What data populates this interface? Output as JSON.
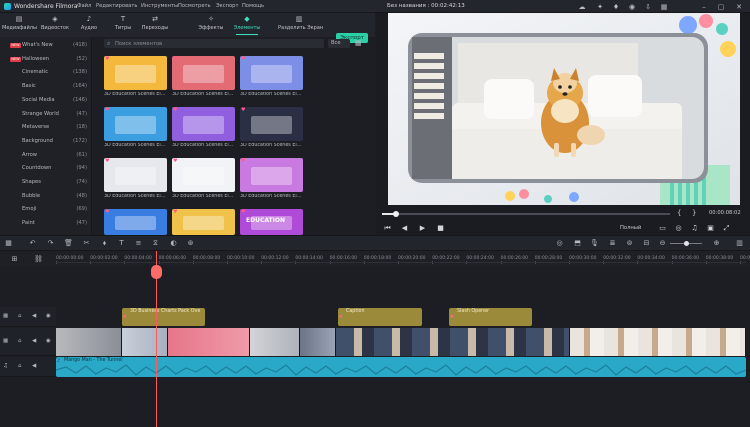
{
  "app": {
    "name": "Wondershare Filmora",
    "menu": [
      "Файл",
      "Редактировать",
      "Инструменты",
      "Посмотреть",
      "Экспорт",
      "Помощь"
    ],
    "preview_title": "Без названия : 00:02:42:13"
  },
  "tabs": [
    {
      "label": "Медиафайлы",
      "icon": "folder-icon"
    },
    {
      "label": "Видеосток",
      "icon": "stock-icon"
    },
    {
      "label": "Аудио",
      "icon": "music-icon"
    },
    {
      "label": "Титры",
      "icon": "text-icon"
    },
    {
      "label": "Переходы",
      "icon": "transition-icon"
    },
    {
      "label": "Эффекты",
      "icon": "effects-icon"
    },
    {
      "label": "Элементы",
      "icon": "elements-icon"
    },
    {
      "label": "Разделить Экран",
      "icon": "split-screen-icon"
    }
  ],
  "export_label": "Экспорт",
  "sidebar": [
    {
      "name": "What's New",
      "count": "(418)",
      "badge": "NEW"
    },
    {
      "name": "Halloween",
      "count": "(52)",
      "badge": "NEW"
    },
    {
      "name": "Cinematic",
      "count": "(138)"
    },
    {
      "name": "Basic",
      "count": "(164)"
    },
    {
      "name": "Social Media",
      "count": "(146)"
    },
    {
      "name": "Strange World",
      "count": "(47)"
    },
    {
      "name": "Metaverse",
      "count": "(18)"
    },
    {
      "name": "Background",
      "count": "(172)"
    },
    {
      "name": "Arrow",
      "count": "(61)"
    },
    {
      "name": "Countdown",
      "count": "(94)"
    },
    {
      "name": "Shapes",
      "count": "(74)"
    },
    {
      "name": "Bubble",
      "count": "(48)"
    },
    {
      "name": "Emoji",
      "count": "(69)"
    },
    {
      "name": "Paint",
      "count": "(47)"
    }
  ],
  "search": {
    "placeholder": "Поиск элементов",
    "filter": "Все"
  },
  "thumbnails": [
    {
      "caption": "3D Education Scenes El...",
      "bg": "#f4b93c"
    },
    {
      "caption": "3D Education Scenes El...",
      "bg": "#e36b74"
    },
    {
      "caption": "3D Education Scenes El...",
      "bg": "#7d8ee6"
    },
    {
      "caption": "3D Education Scenes El...",
      "bg": "#3a9ee0"
    },
    {
      "caption": "3D Education Scenes El...",
      "bg": "#8f5fe0"
    },
    {
      "caption": "3D Education Scenes El...",
      "bg": "#2a2f44"
    },
    {
      "caption": "3D Education Scenes El...",
      "bg": "#e6e8ee"
    },
    {
      "caption": "3D Education Scenes El...",
      "bg": "#f2f3f6"
    },
    {
      "caption": "3D Education Scenes El...",
      "bg": "#c97ae0"
    },
    {
      "caption": "",
      "bg": "#3a7de0"
    },
    {
      "caption": "",
      "bg": "#f0c24a"
    },
    {
      "caption": "EDUCATION",
      "bg": "#b04ad8"
    }
  ],
  "preview": {
    "timecode": "00:00:08:02",
    "quality": "Полный",
    "progress": 0.05
  },
  "ruler": [
    "00:00:00:00",
    "00:00:02:00",
    "00:00:04:00",
    "00:00:06:00",
    "00:00:08:00",
    "00:00:10:00",
    "00:00:12:00",
    "00:00:14:00",
    "00:00:16:00",
    "00:00:18:00",
    "00:00:20:00",
    "00:00:22:00",
    "00:00:24:00",
    "00:00:26:00",
    "00:00:28:00",
    "00:00:30:00",
    "00:00:32:00",
    "00:00:34:00",
    "00:00:36:00",
    "00:00:38:00",
    "00:00:40:00"
  ],
  "title_clips": [
    "3D Business Charts Pack Ove",
    "Caption",
    "Slash Opener"
  ],
  "audio_clip": "Mango Man - The Tunnel"
}
